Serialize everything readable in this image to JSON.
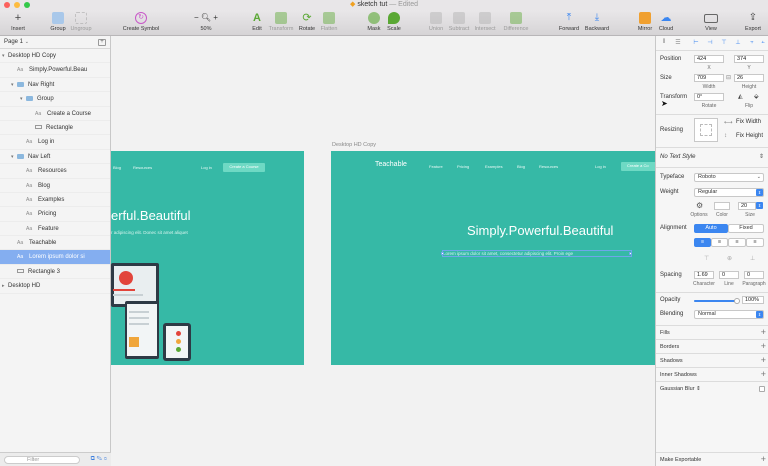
{
  "window": {
    "title": "sketch tut",
    "edited_suffix": "— Edited",
    "controls": {
      "close": "#fc615d",
      "minimize": "#fdbc40",
      "maximize": "#34c84a"
    }
  },
  "toolbar": {
    "insert": "Insert",
    "group": "Group",
    "ungroup": "Ungroup",
    "create_symbol": "Create Symbol",
    "zoom": "50%",
    "edit": "Edit",
    "transform": "Transform",
    "rotate": "Rotate",
    "flatten": "Flatten",
    "mask": "Mask",
    "scale": "Scale",
    "union": "Union",
    "subtract": "Subtract",
    "intersect": "Intersect",
    "difference": "Difference",
    "forward": "Forward",
    "backward": "Backward",
    "mirror": "Mirror",
    "cloud": "Cloud",
    "view": "View",
    "export": "Export"
  },
  "layers": {
    "page": "Page 1",
    "items": [
      {
        "name": "Desktop HD Copy",
        "kind": "artboard",
        "depth": 0,
        "expanded": true
      },
      {
        "name": "Simply.Powerful.Beau",
        "kind": "text",
        "depth": 1
      },
      {
        "name": "Nav Right",
        "kind": "folder",
        "depth": 1,
        "expanded": true
      },
      {
        "name": "Group",
        "kind": "folder",
        "depth": 2,
        "expanded": true
      },
      {
        "name": "Create a Course",
        "kind": "text",
        "depth": 3
      },
      {
        "name": "Rectangle",
        "kind": "rect",
        "depth": 3
      },
      {
        "name": "Log in",
        "kind": "text",
        "depth": 2
      },
      {
        "name": "Nav Left",
        "kind": "folder",
        "depth": 1,
        "expanded": true
      },
      {
        "name": "Resources",
        "kind": "text",
        "depth": 2
      },
      {
        "name": "Blog",
        "kind": "text",
        "depth": 2
      },
      {
        "name": "Examples",
        "kind": "text",
        "depth": 2
      },
      {
        "name": "Pricing",
        "kind": "text",
        "depth": 2
      },
      {
        "name": "Feature",
        "kind": "text",
        "depth": 2
      },
      {
        "name": "Teachable",
        "kind": "text",
        "depth": 1
      },
      {
        "name": "Lorem ipsum dolor si",
        "kind": "text",
        "depth": 1,
        "selected": true
      },
      {
        "name": "Rectangle 3",
        "kind": "rect",
        "depth": 1
      },
      {
        "name": "Desktop HD",
        "kind": "artboard",
        "depth": 0,
        "expanded": false
      }
    ],
    "filter_placeholder": "Filter"
  },
  "canvas": {
    "artboard_left": {
      "nav": [
        "Blog",
        "Resources"
      ],
      "login": "Log in",
      "cta": "Create a Course",
      "hero": "erful.Beautiful",
      "sub": "r adipiscing elit. Donec sit amet aliquet"
    },
    "artboard_right": {
      "label": "Desktop HD Copy",
      "brand": "Teachable",
      "nav": [
        "Feature",
        "Pricing",
        "Examples",
        "Blog",
        "Resources"
      ],
      "login": "Log in",
      "cta": "Create a Co",
      "hero": "Simply.Powerful.Beautiful",
      "sub": "Lorem ipsum dolor sit amet, consectetur adipiscing elit. Proin ege"
    },
    "bg_color": "#36b9a6"
  },
  "inspector": {
    "position": {
      "label": "Position",
      "x": "424",
      "y": "374",
      "x_label": "X",
      "y_label": "Y"
    },
    "size": {
      "label": "Size",
      "width": "709",
      "height": "26",
      "width_label": "Width",
      "height_label": "Height"
    },
    "transform": {
      "label": "Transform",
      "rotate": "0°",
      "rotate_label": "Rotate",
      "flip_label": "Flip"
    },
    "resizing": {
      "label": "Resizing",
      "fix_width": "Fix Width",
      "fix_height": "Fix Height"
    },
    "text_style": "No Text Style",
    "typeface": {
      "label": "Typeface",
      "value": "Roboto"
    },
    "weight": {
      "label": "Weight",
      "value": "Regular"
    },
    "options_label": "Options",
    "color_label": "Color",
    "size_value": "20",
    "size_label": "Size",
    "alignment": {
      "label": "Alignment",
      "auto": "Auto",
      "fixed": "Fixed"
    },
    "spacing": {
      "label": "Spacing",
      "character": "1.69",
      "line": "0",
      "paragraph": "0",
      "character_label": "Character",
      "line_label": "Line",
      "paragraph_label": "Paragraph"
    },
    "opacity": {
      "label": "Opacity",
      "value": "100%",
      "level": 1.0
    },
    "blending": {
      "label": "Blending",
      "value": "Normal"
    },
    "sections": [
      "Fills",
      "Borders",
      "Shadows",
      "Inner Shadows",
      "Gaussian Blur"
    ],
    "export": "Make Exportable",
    "accent": "#3b86f0"
  }
}
